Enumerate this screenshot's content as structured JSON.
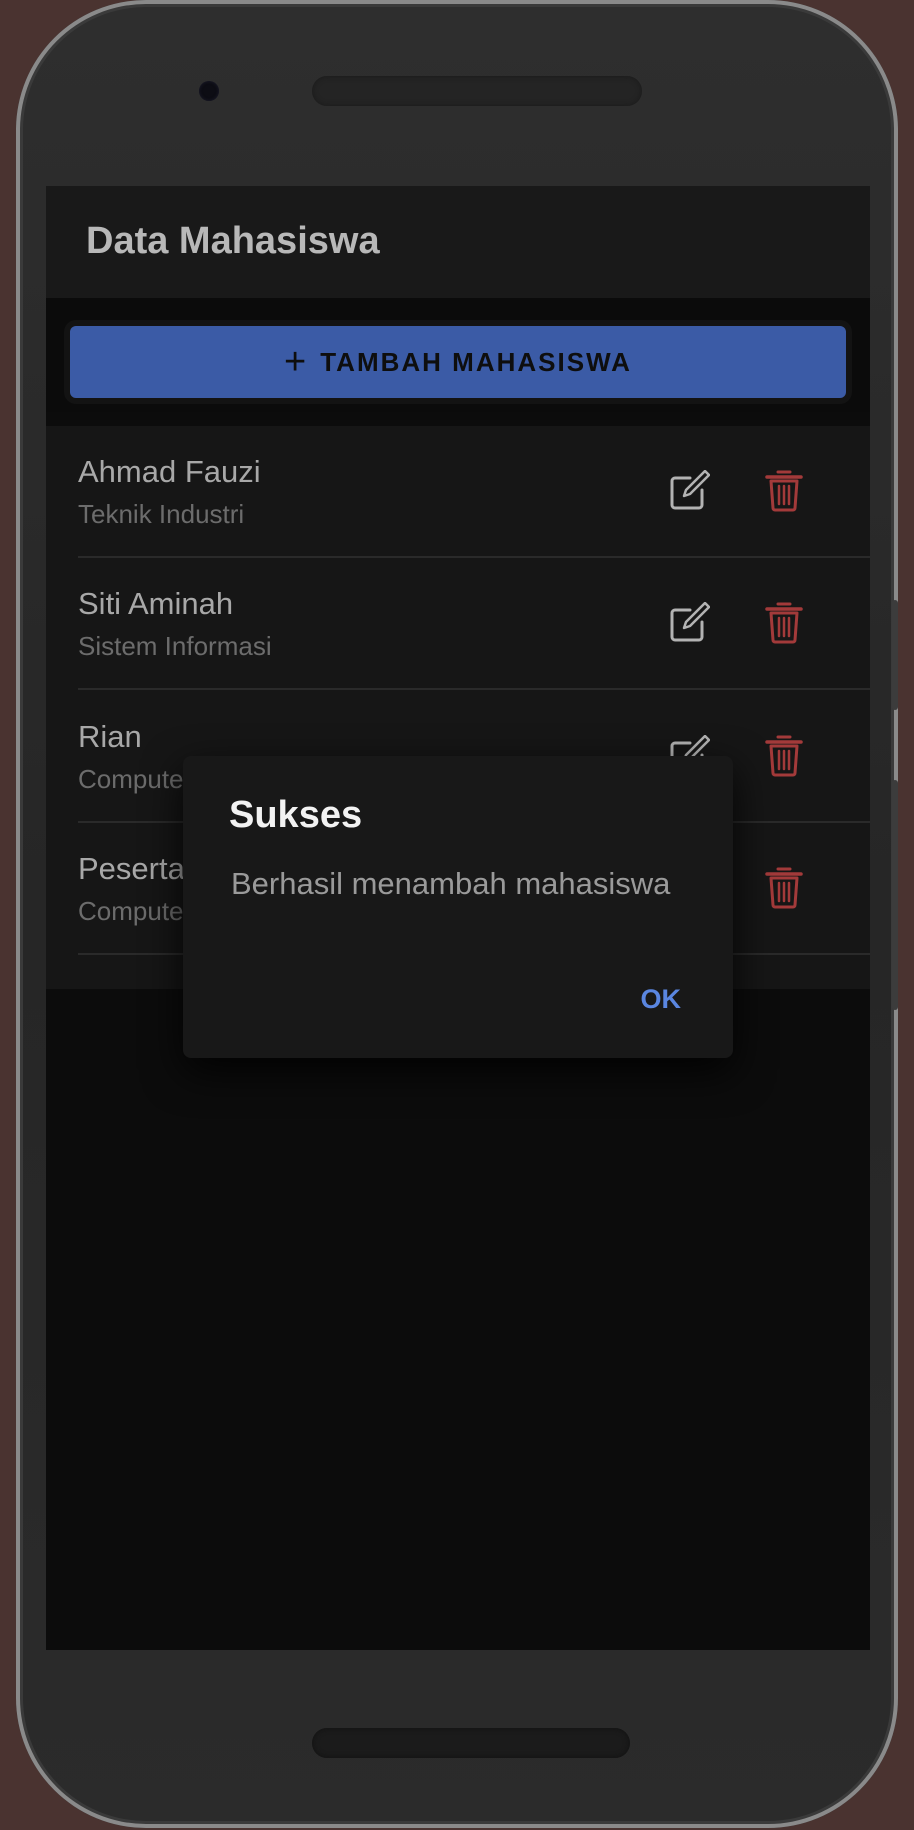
{
  "app": {
    "title": "Data Mahasiswa"
  },
  "add_button": {
    "icon": "plus-icon",
    "label": "TAMBAH MAHASISWA"
  },
  "students": [
    {
      "name": "Ahmad Fauzi",
      "program": "Teknik Industri"
    },
    {
      "name": "Siti Aminah",
      "program": "Sistem Informasi"
    },
    {
      "name": "Rian",
      "program": "Compute"
    },
    {
      "name": "Peserta",
      "program": "Compute"
    }
  ],
  "icons": {
    "edit": "edit-icon",
    "delete": "trash-icon"
  },
  "dialog": {
    "title": "Sukses",
    "message": "Berhasil menambah mahasiswa",
    "ok_label": "OK"
  },
  "colors": {
    "accent": "#3b5ba6",
    "dialog_button": "#5a86e0",
    "delete": "#a33a3a",
    "background": "#0c0c0c"
  }
}
